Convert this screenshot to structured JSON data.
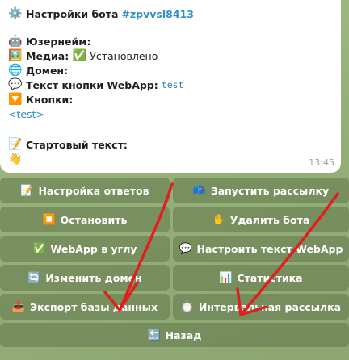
{
  "message": {
    "title": "Настройки бота",
    "bot_tag": "#zpvvsl8413",
    "fields": {
      "username_label": "Юзернейм:",
      "media_label": "Медиа:",
      "media_value": "Установлено",
      "domain_label": "Домен:",
      "webapp_button_label": "Текст кнопки WebApp:",
      "webapp_button_value": "test",
      "buttons_label": "Кнопки:",
      "buttons_value": "<test>",
      "start_text_label": "Стартовый текст:"
    },
    "time": "13:45"
  },
  "keyboard": {
    "setup_replies": "Настройка ответов",
    "start_broadcast": "Запустить рассылку",
    "stop": "Остановить",
    "delete_bot": "Удалить бота",
    "webapp_corner": "WebApp в углу",
    "setup_webapp_text": "Настроить текст WebApp",
    "change_domain": "Изменить домен",
    "statistics": "Статистика",
    "export_db": "Экспорт базы данных",
    "interval_broadcast": "Интервальная рассылка",
    "back": "Назад"
  },
  "icons": {
    "settings": "gear-icon",
    "username": "robot-icon",
    "media": "picture-icon",
    "domain": "globe-icon",
    "webapp_text": "speech-bubble-icon",
    "buttons": "arrow-down-box-icon",
    "start_text": "memo-icon",
    "wave": "waving-hand-icon"
  },
  "colors": {
    "link": "#2f8fc8",
    "keyboard_button": "#60764a",
    "annotation_arrow": "#e02020"
  }
}
